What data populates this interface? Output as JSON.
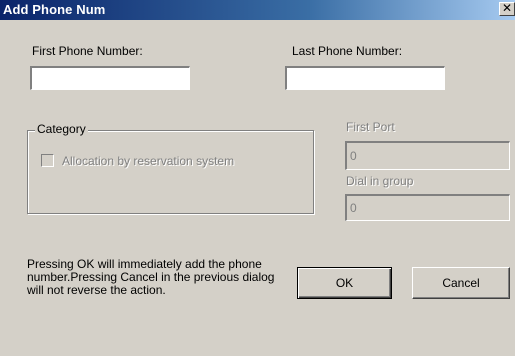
{
  "window": {
    "title": "Add Phone Num",
    "close_glyph": "✕"
  },
  "fields": {
    "first_phone_label": "First Phone Number:",
    "first_phone_value": "",
    "last_phone_label": "Last Phone Number:",
    "last_phone_value": "",
    "first_port_label": "First Port",
    "first_port_value": "0",
    "dial_in_group_label": "Dial in group",
    "dial_in_group_value": "0"
  },
  "category": {
    "legend": "Category",
    "checkbox_label": "Allocation by reservation system",
    "checked": false
  },
  "info": {
    "message": "Pressing OK will immediately add the phone number.Pressing Cancel in the previous dialog will not reverse the action."
  },
  "buttons": {
    "ok_label": "OK",
    "cancel_label": "Cancel"
  },
  "colors": {
    "titlebar_start": "#0a246a",
    "titlebar_end": "#a6caf0",
    "face": "#d4d0c8",
    "disabled_text": "#808080"
  }
}
